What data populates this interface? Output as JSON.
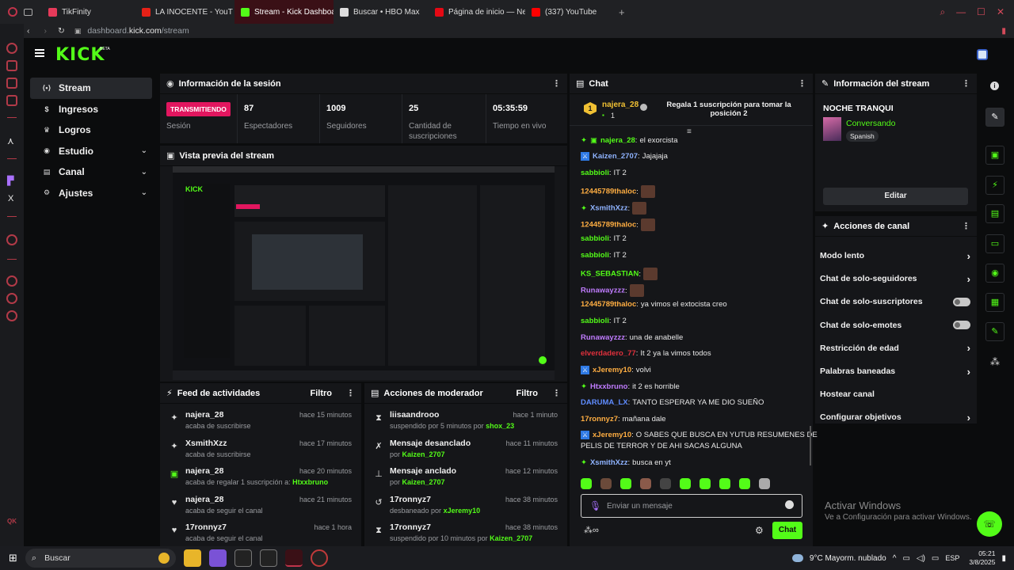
{
  "browser": {
    "tabs": [
      {
        "label": "TikFinity",
        "color": "#e63a5a",
        "active": false
      },
      {
        "label": "LA INOCENTE - YouT",
        "color": "#e62117",
        "active": false
      },
      {
        "label": "Stream - Kick Dashboard",
        "color": "#53fc18",
        "active": true
      },
      {
        "label": "Buscar • HBO Max",
        "color": "#dddddd",
        "active": false
      },
      {
        "label": "Página de inicio — Netflix",
        "color": "#e50914",
        "active": false
      },
      {
        "label": "(337) YouTube",
        "color": "#ff0000",
        "active": false
      }
    ],
    "url_host": "dashboard.",
    "url_domain": "kick.com",
    "url_path": "/stream"
  },
  "kick": {
    "logo": "KICK",
    "logo_beta": "BETA"
  },
  "nav": {
    "items": [
      {
        "label": "Stream",
        "icon": "broadcast-icon",
        "selected": true,
        "chevron": false
      },
      {
        "label": "Ingresos",
        "icon": "money-icon",
        "selected": false,
        "chevron": false
      },
      {
        "label": "Logros",
        "icon": "trophy-icon",
        "selected": false,
        "chevron": false
      },
      {
        "label": "Estudio",
        "icon": "studio-icon",
        "selected": false,
        "chevron": true
      },
      {
        "label": "Canal",
        "icon": "channel-icon",
        "selected": false,
        "chevron": true
      },
      {
        "label": "Ajustes",
        "icon": "gear-icon",
        "selected": false,
        "chevron": true
      }
    ]
  },
  "session": {
    "title": "Información de la sesión",
    "live_badge": "TRANSMITIENDO",
    "live_label": "Sesión",
    "stats": [
      {
        "value": "87",
        "label": "Espectadores"
      },
      {
        "value": "1009",
        "label": "Seguidores"
      },
      {
        "value": "25",
        "label": "Cantidad de suscripciones"
      },
      {
        "value": "05:35:59",
        "label": "Tiempo en vivo"
      }
    ]
  },
  "preview": {
    "title": "Vista previa del stream"
  },
  "feed": {
    "title": "Feed de actividades",
    "filter": "Filtro",
    "items": [
      {
        "name": "najera_28",
        "text": "acaba de suscribirse",
        "highlight": "",
        "time": "hace 15 minutos",
        "icon": "sparkle-icon"
      },
      {
        "name": "XsmithXzz",
        "text": "acaba de suscribirse",
        "highlight": "",
        "time": "hace 17 minutos",
        "icon": "sparkle-icon"
      },
      {
        "name": "najera_28",
        "text": "acaba de regalar 1 suscripción a: ",
        "highlight": "Htxxbruno",
        "time": "hace 20 minutos",
        "icon": "gift-icon"
      },
      {
        "name": "najera_28",
        "text": "acaba de seguir el canal",
        "highlight": "",
        "time": "hace 21 minutos",
        "icon": "heart-icon"
      },
      {
        "name": "17ronnyz7",
        "text": "acaba de seguir el canal",
        "highlight": "",
        "time": "hace 1 hora",
        "icon": "heart-icon"
      }
    ]
  },
  "modactions": {
    "title": "Acciones de moderador",
    "filter": "Filtro",
    "items": [
      {
        "name": "liisaandrooo",
        "text": "suspendido por 5 minutos por ",
        "highlight": "shox_23",
        "time": "hace 1 minuto",
        "icon": "hourglass-icon"
      },
      {
        "name": "Mensaje desanclado",
        "text": "por ",
        "highlight": "Kaizen_2707",
        "time": "hace 11 minutos",
        "icon": "unpin-icon"
      },
      {
        "name": "Mensaje anclado",
        "text": "por ",
        "highlight": "Kaizen_2707",
        "time": "hace 12 minutos",
        "icon": "pin-icon"
      },
      {
        "name": "17ronnyz7",
        "text": "desbaneado por ",
        "highlight": "xJeremy10",
        "time": "hace 38 minutos",
        "icon": "undo-icon"
      },
      {
        "name": "17ronnyz7",
        "text": "suspendido por 10 minutos por ",
        "highlight": "Kaizen_2707",
        "time": "hace 38 minutos",
        "icon": "hourglass-icon"
      }
    ]
  },
  "chat": {
    "title": "Chat",
    "pinned_user": "najera_28",
    "pinned_count": "1",
    "pinned_text": "Regala 1 suscripción para tomar la posición 2",
    "messages": [
      {
        "user": "najera_28",
        "color": "#53fc18",
        "text": "el exorcista",
        "badge": "sparkle"
      },
      {
        "user": "Kaizen_2707",
        "color": "#8fb3ff",
        "text": "Jajajaja",
        "badge": "sword"
      },
      {
        "user": "sabbioli",
        "color": "#53fc18",
        "text": "IT 2",
        "badge": ""
      },
      {
        "user": "12445789thaloc",
        "color": "#ffae42",
        "text": "",
        "badge": "",
        "emote": true
      },
      {
        "user": "XsmithXzz",
        "color": "#8fb3ff",
        "text": "",
        "badge": "sparkle",
        "emote": true
      },
      {
        "user": "12445789thaloc",
        "color": "#ffae42",
        "text": "",
        "badge": "",
        "emote": true
      },
      {
        "user": "sabbioli",
        "color": "#53fc18",
        "text": "IT 2",
        "badge": ""
      },
      {
        "user": "sabbioli",
        "color": "#53fc18",
        "text": "IT 2",
        "badge": ""
      },
      {
        "user": "KS_SEBASTIAN",
        "color": "#53fc18",
        "text": "",
        "badge": "",
        "emote": true
      },
      {
        "user": "Runawayzzz",
        "color": "#c07cff",
        "text": "",
        "badge": "",
        "emote": true
      },
      {
        "user": "12445789thaloc",
        "color": "#ffae42",
        "text": "ya vimos el extocista creo",
        "badge": ""
      },
      {
        "user": "sabbioli",
        "color": "#53fc18",
        "text": "IT 2",
        "badge": ""
      },
      {
        "user": "Runawayzzz",
        "color": "#c07cff",
        "text": "una de anabelle",
        "badge": ""
      },
      {
        "user": "elverdadero_77",
        "color": "#e0303c",
        "text": "It 2 ya la vimos todos",
        "badge": ""
      },
      {
        "user": "xJeremy10",
        "color": "#ffae42",
        "text": "volvi",
        "badge": "sword"
      },
      {
        "user": "Htxxbruno",
        "color": "#c07cff",
        "text": "it 2 es horrible",
        "badge": "sparkle"
      },
      {
        "user": "DARUMA_LX",
        "color": "#5f8cff",
        "text": "TANTO ESPERAR YA ME DIO SUEÑO",
        "badge": ""
      },
      {
        "user": "17ronnyz7",
        "color": "#ffae42",
        "text": "mañana dale",
        "badge": ""
      },
      {
        "user": "xJeremy10",
        "color": "#ffae42",
        "text": "O SABES QUE BUSCA EN YUTUB RESUMENES DE",
        "text2": "PELIS DE TERROR Y DE AHI SACAS ALGUNA",
        "badge": "sword"
      },
      {
        "user": "XsmithXzz",
        "color": "#8fb3ff",
        "text": "busca en yt",
        "badge": "sparkle"
      }
    ],
    "input_placeholder": "Enviar un mensaje",
    "send_label": "Chat"
  },
  "streaminfo": {
    "title": "Información del stream",
    "stream_title": "NOCHE TRANQUI",
    "category": "Conversando",
    "language": "Spanish",
    "edit_label": "Editar"
  },
  "channelactions": {
    "title": "Acciones de canal",
    "items": [
      {
        "label": "Modo lento",
        "control": "chevron"
      },
      {
        "label": "Chat de solo-seguidores",
        "control": "chevron"
      },
      {
        "label": "Chat de solo-suscriptores",
        "control": "toggle"
      },
      {
        "label": "Chat de solo-emotes",
        "control": "toggle"
      },
      {
        "label": "Restricción de edad",
        "control": "chevron"
      },
      {
        "label": "Palabras baneadas",
        "control": "chevron"
      },
      {
        "label": "Hostear canal",
        "control": "none"
      },
      {
        "label": "Configurar objetivos",
        "control": "chevron"
      }
    ]
  },
  "windows_notice": {
    "title": "Activar Windows",
    "subtitle": "Ve a Configuración para activar Windows."
  },
  "taskbar": {
    "search": "Buscar",
    "weather": "9°C  Mayorm. nublado",
    "lang": "ESP",
    "time": "05:21",
    "date": "3/8/2025"
  }
}
